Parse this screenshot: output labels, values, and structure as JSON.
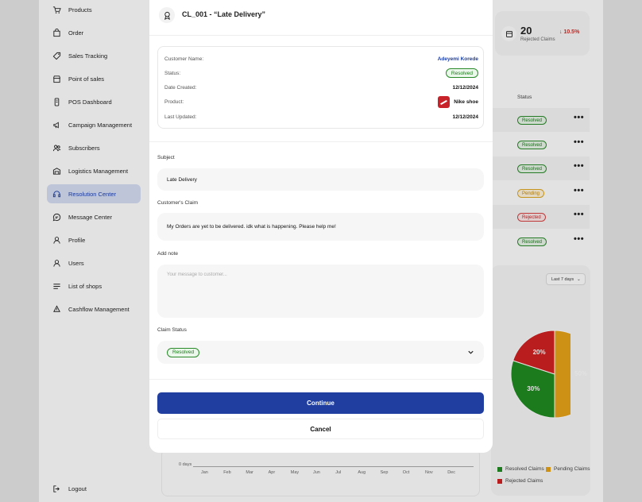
{
  "sidebar": {
    "items": [
      {
        "label": "Products",
        "icon": "cart-icon"
      },
      {
        "label": "Order",
        "icon": "bag-icon"
      },
      {
        "label": "Sales Tracking",
        "icon": "tag-icon"
      },
      {
        "label": "Point of sales",
        "icon": "store-icon"
      },
      {
        "label": "POS Dashboard",
        "icon": "pos-terminal-icon"
      },
      {
        "label": "Campaign Management",
        "icon": "megaphone-icon"
      },
      {
        "label": "Subscribers",
        "icon": "users-icon"
      },
      {
        "label": "Logistics Management",
        "icon": "warehouse-icon"
      },
      {
        "label": "Resolution Center",
        "icon": "headset-icon",
        "active": true
      },
      {
        "label": "Message Center",
        "icon": "chat-icon"
      },
      {
        "label": "Profile",
        "icon": "person-icon"
      },
      {
        "label": "Users",
        "icon": "person-icon"
      },
      {
        "label": "List of shops",
        "icon": "list-icon"
      },
      {
        "label": "Cashflow Management",
        "icon": "money-icon"
      }
    ],
    "logout": "Logout"
  },
  "stat": {
    "value": "20",
    "label": "Rejected Claims",
    "trend": "10.5%"
  },
  "table": {
    "status_header": "Status",
    "rows": [
      {
        "status": "Resolved",
        "kind": "resolved"
      },
      {
        "status": "Resolved",
        "kind": "resolved"
      },
      {
        "status": "Resolved",
        "kind": "resolved"
      },
      {
        "status": "Pending",
        "kind": "pending"
      },
      {
        "status": "Rejected",
        "kind": "rejected"
      },
      {
        "status": "Resolved",
        "kind": "resolved"
      }
    ],
    "more_label": "•••"
  },
  "chart_data": {
    "type": "pie",
    "slices": [
      {
        "label": "Pending Claims",
        "value": 50,
        "text": "50%",
        "color": "#e8a317"
      },
      {
        "label": "Resolved Claims",
        "value": 30,
        "text": "30%",
        "color": "#1e8a1e"
      },
      {
        "label": "Rejected Claims",
        "value": 20,
        "text": "20%",
        "color": "#d11f1f"
      }
    ],
    "legend": [
      "Resolved Claims",
      "Pending Claims",
      "Rejected Claims"
    ],
    "range": "Last 7 days"
  },
  "line_chart": {
    "y_tick": "0 days",
    "months": [
      "Jan",
      "Feb",
      "Mar",
      "Apr",
      "May",
      "Jun",
      "Jul",
      "Aug",
      "Sep",
      "Oct",
      "Nov",
      "Dec"
    ]
  },
  "modal": {
    "title": "CL_001 - “Late Delivery”",
    "info": {
      "customer_label": "Customer Name:",
      "customer_value": "Adeyemi Korede",
      "status_label": "Status:",
      "status_value": "Resolved",
      "created_label": "Date Created:",
      "created_value": "12/12/2024",
      "product_label": "Product:",
      "product_value": "Nike shoe",
      "updated_label": "Last Updated:",
      "updated_value": "12/12/2024"
    },
    "subject_label": "Subject",
    "subject_value": "Late Delivery",
    "claim_label": "Customer's Claim",
    "claim_value": "My Orders are yet to be delivered. idk what is happening. Please help me!",
    "note_label": "Add note",
    "note_placeholder": "Your message to customer...",
    "claim_status_label": "Claim Status",
    "claim_status_value": "Resolved",
    "continue_label": "Continue",
    "cancel_label": "Cancel"
  },
  "colors": {
    "primary": "#1f3ea0",
    "resolved": "#1e8a1e",
    "pending": "#e8a317",
    "rejected": "#d11f1f"
  }
}
